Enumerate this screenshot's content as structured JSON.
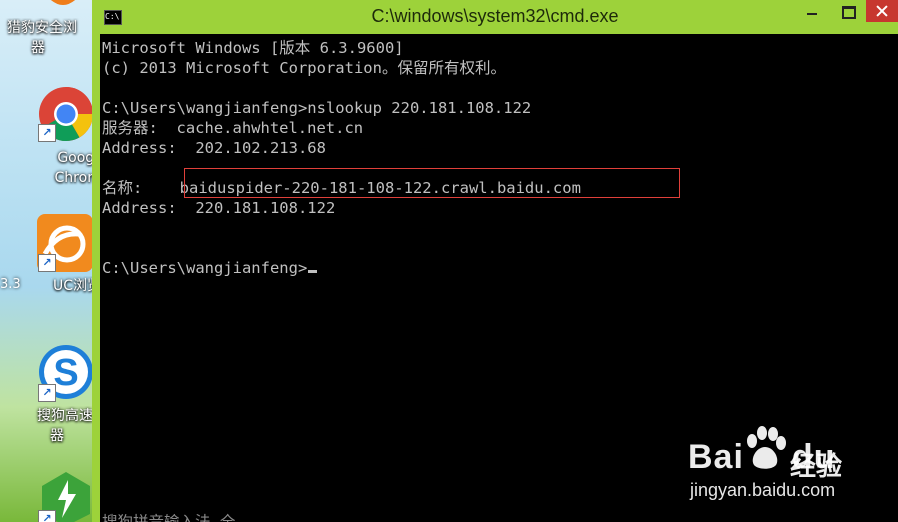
{
  "desktop": {
    "icons": [
      {
        "label": "猎豹安全浏",
        "label2": "器",
        "icon": "liebao-browser-icon"
      },
      {
        "label": "Google",
        "label2": "Chrome",
        "icon": "chrome-icon"
      },
      {
        "label": "UC浏览器",
        "icon": "uc-browser-icon"
      },
      {
        "label": "搜狗高速浏",
        "label2": "器",
        "icon": "sogou-browser-icon"
      },
      {
        "label": "",
        "icon": "360-icon"
      }
    ],
    "edge_text": "3.3",
    "shortcut_glyph": "↗"
  },
  "window": {
    "title": "C:\\windows\\system32\\cmd.exe",
    "icon_text": "C:\\",
    "accent_color": "#9dd23a",
    "close_color": "#c7372f"
  },
  "console": {
    "lines": [
      "Microsoft Windows [版本 6.3.9600]",
      "(c) 2013 Microsoft Corporation。保留所有权利。",
      "",
      "C:\\Users\\wangjianfeng>nslookup 220.181.108.122",
      "服务器:  cache.ahwhtel.net.cn",
      "Address:  202.102.213.68",
      "",
      "名称:    baiduspider-220-181-108-122.crawl.baidu.com",
      "Address:  220.181.108.122",
      "",
      "",
      "C:\\Users\\wangjianfeng>"
    ],
    "bottom_partial": "搜狗拼音输入法 全",
    "text_color": "#c0c0c0",
    "highlight_color": "#e0403a"
  },
  "watermark": {
    "brand": "Bai",
    "brand_suffix": "du",
    "cn": "经验",
    "url": "jingyan.baidu.com"
  }
}
